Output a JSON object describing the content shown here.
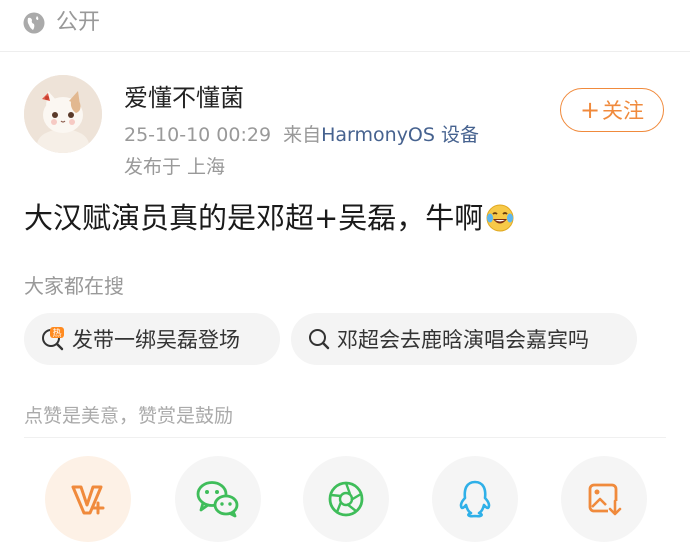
{
  "visibility": {
    "icon": "globe-icon",
    "label": "公开"
  },
  "post": {
    "author": {
      "name": "爱懂不懂菌",
      "avatar": "cat-avatar"
    },
    "timestamp": "25-10-10 00:29",
    "source_prefix": "来自",
    "source_device": "HarmonyOS 设备",
    "location": "发布于 上海",
    "follow_label": "关注",
    "text": "大汉赋演员真的是邓超+吴磊，牛啊",
    "emoji": "laughing-tears-emoji"
  },
  "search": {
    "title": "大家都在搜",
    "chips": [
      {
        "icon": "hot-search-icon",
        "label": "发带一绑吴磊登场"
      },
      {
        "icon": "search-icon",
        "label": "邓超会去鹿晗演唱会嘉宾吗"
      }
    ]
  },
  "reward": {
    "title": "点赞是美意，赞赏是鼓励"
  },
  "share": {
    "items": [
      {
        "icon": "vplus-icon"
      },
      {
        "icon": "wechat-icon"
      },
      {
        "icon": "moments-icon"
      },
      {
        "icon": "qq-icon"
      },
      {
        "icon": "save-image-icon"
      }
    ]
  },
  "colors": {
    "accent": "#f08a3c",
    "device_link": "#46628f",
    "muted_text": "#999999",
    "chip_bg": "#f4f4f4",
    "wechat_green": "#3fbd5a",
    "qq_blue": "#2fb0e8"
  }
}
